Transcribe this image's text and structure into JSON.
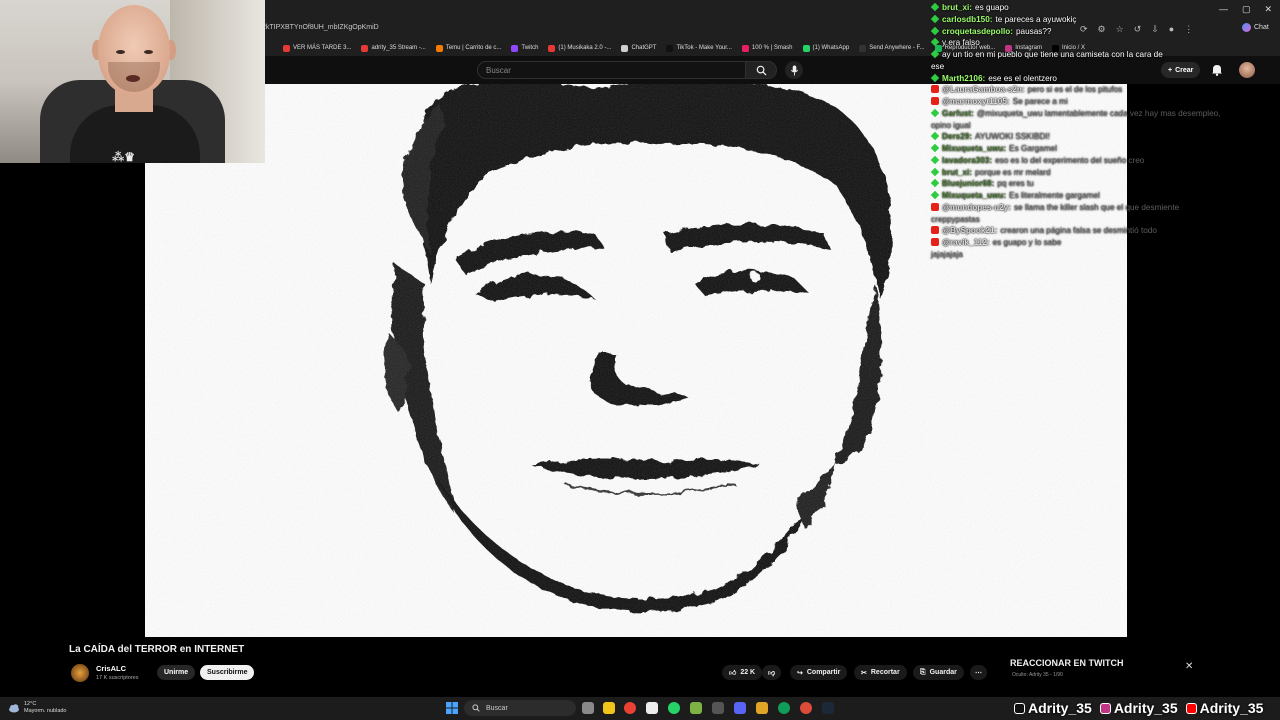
{
  "browser": {
    "url_fragment": "2kTIPXBTYnOf8UH_mbIZKgOpKmiD",
    "bookmarks": [
      {
        "label": "VER MÁS TARDE 3...",
        "color": "#e53935"
      },
      {
        "label": "adrity_35 Stream -...",
        "color": "#e53935"
      },
      {
        "label": "Temu | Carrito de c...",
        "color": "#f57c00"
      },
      {
        "label": "Twitch",
        "color": "#9146ff"
      },
      {
        "label": "(1) Musikaka 2.0 -...",
        "color": "#e53935"
      },
      {
        "label": "ChatGPT",
        "color": "#cfcfcf"
      },
      {
        "label": "TikTok - Make Your...",
        "color": "#111111"
      },
      {
        "label": "100 % | Smash",
        "color": "#e91e63"
      },
      {
        "label": "(1) WhatsApp",
        "color": "#25d366"
      },
      {
        "label": "Send Anywhere - F...",
        "color": "#333333"
      },
      {
        "label": "Reproductor web...",
        "color": "#1db954"
      },
      {
        "label": "Instagram",
        "color": "#c13584"
      },
      {
        "label": "Inicio / X",
        "color": "#000000"
      }
    ],
    "chat_button": "Chat"
  },
  "youtube": {
    "search_placeholder": "Buscar",
    "create_label": "Crear",
    "video_title": "La CAÍDA del TERROR en INTERNET",
    "channel_name": "CrisALC",
    "subscribers": "17 K suscriptores",
    "join_label": "Unirme",
    "subscribe_label": "Suscribirme",
    "likes": "22 K",
    "share_label": "Compartir",
    "clip_label": "Recortar",
    "save_label": "Guardar"
  },
  "react_panel": {
    "title": "REACCIONAR EN TWITCH",
    "subtitle": "Oculto: Adrity 35 - 1/90"
  },
  "chat": [
    {
      "platform": "twitch",
      "user": "brut_xi",
      "msg": "es guapo",
      "faded": false
    },
    {
      "platform": "twitch",
      "user": "carlosdb150",
      "msg": "te pareces a ayuwokiç",
      "faded": false
    },
    {
      "platform": "twitch",
      "user": "croquetasdepollo",
      "msg": "pausas??",
      "faded": false
    },
    {
      "platform": "twitch",
      "user": "",
      "msg": "y era falso",
      "faded": false
    },
    {
      "platform": "twitch",
      "user": "",
      "msg": "ay un tio en mi pueblo que tiene una camiseta con la cara de",
      "faded": false
    },
    {
      "platform": "none",
      "user": "",
      "msg": "ese",
      "faded": false
    },
    {
      "platform": "twitch",
      "user": "Marth2106",
      "msg": "ese es el olentzero",
      "faded": false
    },
    {
      "platform": "youtube",
      "user": "@LauraGamboa-s2n",
      "msg": "pero si es el de los pitufos",
      "faded": true
    },
    {
      "platform": "youtube",
      "user": "@marmoxyt1105",
      "msg": "Se parece a mi",
      "faded": true
    },
    {
      "platform": "twitch",
      "user": "Garfust",
      "msg": "@mixuqueta_uwu lamentablemente cada vez hay mas desempleo,",
      "faded": true
    },
    {
      "platform": "none",
      "user": "",
      "msg": "opino igual",
      "faded": true
    },
    {
      "platform": "twitch",
      "user": "Ders29",
      "msg": "AYUWOKI SSKIBDI!",
      "faded": true
    },
    {
      "platform": "twitch",
      "user": "Mixuqueta_uwu",
      "msg": "Es Gargamel",
      "faded": true
    },
    {
      "platform": "twitch",
      "user": "lavadora303",
      "msg": "eso es lo del experimento del sueño creo",
      "faded": true
    },
    {
      "platform": "twitch",
      "user": "brut_xi",
      "msg": "porque es mr melard",
      "faded": true
    },
    {
      "platform": "twitch",
      "user": "Bluejunior68",
      "msg": "pq eres tu",
      "faded": true
    },
    {
      "platform": "twitch",
      "user": "Mixuqueta_uwu",
      "msg": "Es literalmente gargamel",
      "faded": true
    },
    {
      "platform": "youtube",
      "user": "@mundopes-u2y",
      "msg": "se llama the killer slash que el que desmiente",
      "faded": true
    },
    {
      "platform": "none",
      "user": "",
      "msg": "creppypastas",
      "faded": true
    },
    {
      "platform": "youtube",
      "user": "@BySpook21",
      "msg": "crearon una página falsa se desmintió todo",
      "faded": true
    },
    {
      "platform": "youtube",
      "user": "@ravik_112",
      "msg": "es guapo y lo sabe",
      "faded": true
    },
    {
      "platform": "none",
      "user": "",
      "msg": "jajajajaja",
      "faded": true
    }
  ],
  "taskbar": {
    "weather_temp": "12°C",
    "weather_desc": "Mayorm. nublado",
    "search_label": "Buscar"
  },
  "socials": [
    {
      "handle": "Adrity_35",
      "color": "#111111"
    },
    {
      "handle": "Adrity_35",
      "color": "#c13584"
    },
    {
      "handle": "Adrity_35",
      "color": "#ff0000"
    }
  ]
}
